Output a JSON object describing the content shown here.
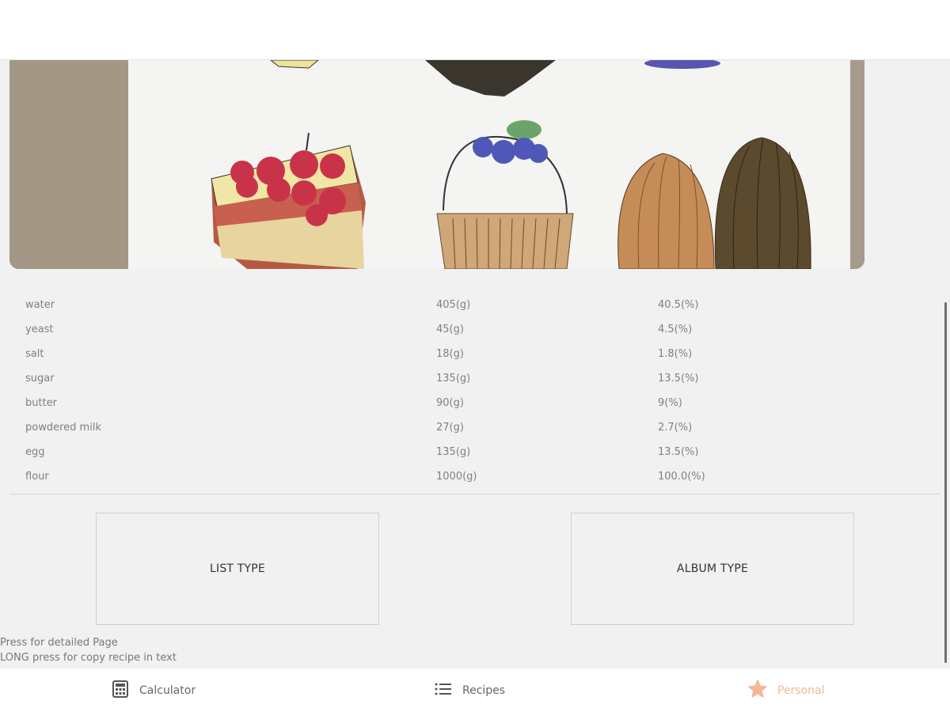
{
  "ingredients": [
    {
      "name": "water",
      "grams": "405(g)",
      "percent": "40.5(%)"
    },
    {
      "name": "yeast",
      "grams": "45(g)",
      "percent": "4.5(%)"
    },
    {
      "name": "salt",
      "grams": "18(g)",
      "percent": "1.8(%)"
    },
    {
      "name": "sugar",
      "grams": "135(g)",
      "percent": "13.5(%)"
    },
    {
      "name": "butter",
      "grams": "90(g)",
      "percent": "9(%)"
    },
    {
      "name": "powdered milk",
      "grams": "27(g)",
      "percent": "2.7(%)"
    },
    {
      "name": "egg",
      "grams": "135(g)",
      "percent": "13.5(%)"
    },
    {
      "name": "flour",
      "grams": "1000(g)",
      "percent": "100.0(%)"
    }
  ],
  "buttons": {
    "list_type": "LIST TYPE",
    "album_type": "ALBUM TYPE"
  },
  "hints": {
    "press": "Press for detailed Page",
    "long_press": "LONG press for copy recipe in text"
  },
  "nav": {
    "calculator": {
      "label": "Calculator",
      "icon": "calculator-icon"
    },
    "recipes": {
      "label": "Recipes",
      "icon": "list-icon"
    },
    "personal": {
      "label": "Personal",
      "icon": "star-icon",
      "active": true
    }
  },
  "colors": {
    "active_tab": "#f2b898",
    "background": "#f1f1f1"
  }
}
